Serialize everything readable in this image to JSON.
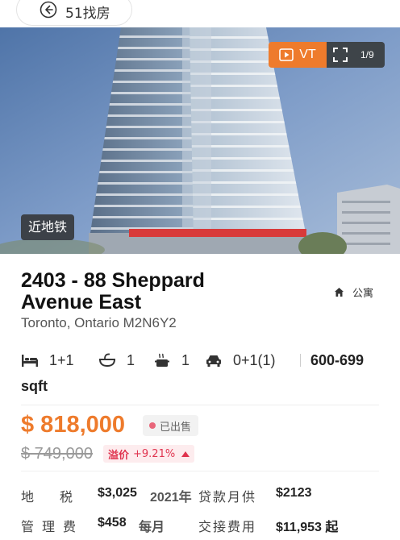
{
  "nav": {
    "back_label": "51找房"
  },
  "gallery": {
    "vt_label": "VT",
    "count": "1/9",
    "badge": "近地铁"
  },
  "listing": {
    "title_line1": "2403 - 88 Sheppard",
    "title_line2": "Avenue East",
    "property_type": "公寓",
    "address": "Toronto, Ontario M2N6Y2"
  },
  "specs": {
    "bedrooms": "1+1",
    "bathrooms": "1",
    "kitchens": "1",
    "parking": "0+1(1)",
    "size_range": "600-699",
    "size_unit": "sqft"
  },
  "pricing": {
    "price": "$ 818,000",
    "status": "已出售",
    "original_price": "$ 749,000",
    "premium_label": "溢价",
    "premium_value": "+9.21%"
  },
  "details": {
    "tax_label": "地　　税",
    "tax_value": "$3,025",
    "tax_year": "2021年",
    "mortgage_label": "贷款月供",
    "mortgage_value": "$2123",
    "fee_label": "管理费",
    "fee_value": "$458",
    "fee_period": "每月",
    "closing_label": "交接费用",
    "closing_value": "$11,953 起"
  },
  "colors": {
    "accent": "#ee7b2c",
    "premium": "#e0344f",
    "badge_dark": "#3c4148"
  },
  "icons": [
    "back-arrow-icon",
    "play-icon",
    "expand-icon",
    "home-icon",
    "bed-icon",
    "bath-icon",
    "kitchen-icon",
    "car-icon"
  ]
}
